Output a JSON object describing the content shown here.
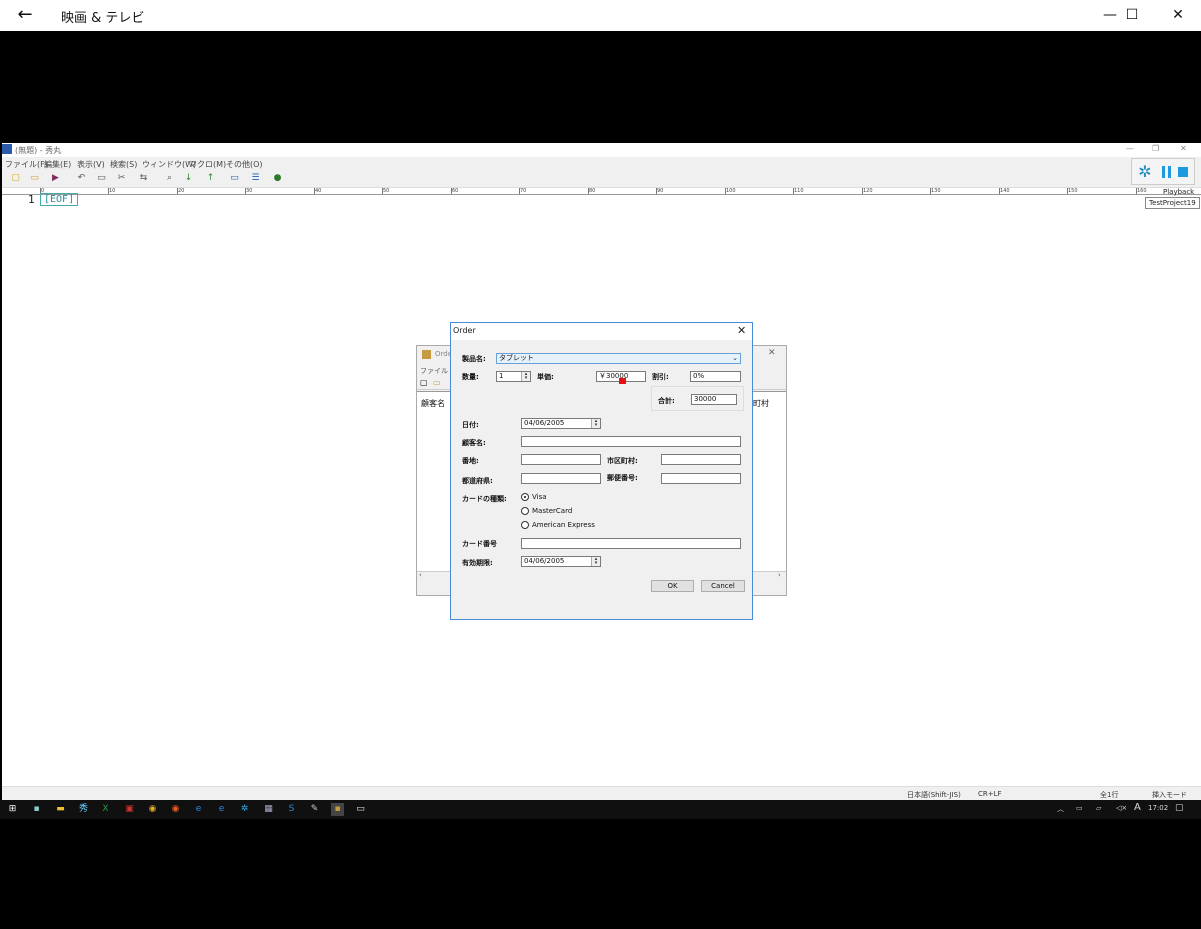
{
  "app": {
    "title": "映画 & テレビ",
    "back_icon": "arrow-left-icon",
    "minimize": "—",
    "maximize": "☐",
    "close": "✕"
  },
  "editor": {
    "title": "(無題) - 秀丸",
    "menu": [
      "ファイル(F)",
      "編集(E)",
      "表示(V)",
      "検索(S)",
      "ウィンドウ(W)",
      "マクロ(M)",
      "その他(O)"
    ],
    "line_number": "1",
    "eof": "[EOF]",
    "ruler": [
      "0",
      "10",
      "20",
      "30",
      "40",
      "50",
      "60",
      "70",
      "80",
      "90",
      "100",
      "110",
      "120",
      "130",
      "140",
      "150",
      "160"
    ],
    "status": {
      "encoding": "日本語(Shift-JIS)",
      "newline": "CR+LF",
      "lines": "全1行",
      "mode": "挿入モード"
    }
  },
  "playback": {
    "tooltip1": "Playback",
    "tooltip2": "TestProject19"
  },
  "bg_form": {
    "title": "Orde",
    "menu": "ファイル",
    "col1": "顧客名",
    "col2": "町村"
  },
  "dialog": {
    "title": "Order",
    "product_label": "製品名:",
    "product_value": "タブレット",
    "qty_label": "数量:",
    "qty_value": "1",
    "price_label": "単価:",
    "price_value": "￥30000",
    "discount_label": "割引:",
    "discount_value": "0%",
    "total_label": "合計:",
    "total_value": "30000",
    "date_label": "日付:",
    "date_value": "04/06/2005",
    "customer_label": "顧客名:",
    "address_label": "番地:",
    "city_label": "市区町村:",
    "prefecture_label": "都道府県:",
    "zip_label": "郵便番号:",
    "card_type_label": "カードの種類:",
    "card_options": [
      "Visa",
      "MasterCard",
      "American Express"
    ],
    "card_selected": "Visa",
    "card_number_label": "カード番号",
    "expiry_label": "有効期限:",
    "expiry_value": "04/06/2005",
    "ok": "OK",
    "cancel": "Cancel"
  },
  "taskbar": {
    "time": "17:02",
    "ime": "A"
  }
}
